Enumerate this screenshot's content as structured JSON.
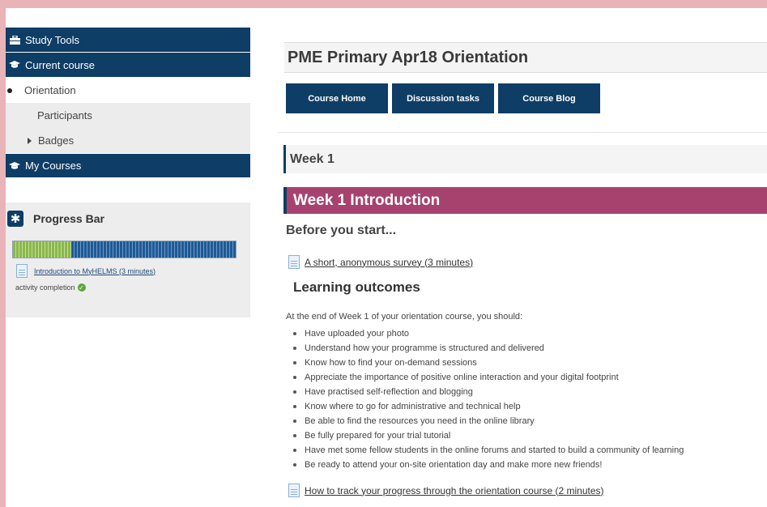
{
  "sidebar": {
    "study_tools": "Study Tools",
    "current_course": "Current course",
    "orientation": "Orientation",
    "participants": "Participants",
    "badges": "Badges",
    "my_courses": "My Courses"
  },
  "progress": {
    "title": "Progress Bar",
    "completed_fraction": 0.26,
    "activity_link": "Introduction to MyHELMS (3 minutes)",
    "status": "activity completion"
  },
  "course": {
    "title": "PME Primary Apr18 Orientation",
    "buttons": [
      "Course Home",
      "Discussion tasks",
      "Course Blog"
    ]
  },
  "week": {
    "label": "Week 1",
    "intro_title": "Week 1 Introduction",
    "before_heading": "Before you start...",
    "survey_link": "A short, anonymous survey (3 minutes)",
    "outcomes_heading": "Learning outcomes",
    "outcomes_intro": "At the end of Week 1 of your orientation course, you should:",
    "outcomes": [
      "Have uploaded your photo",
      "Understand how your programme is structured and delivered",
      "Know how to find your on-demand sessions",
      "Appreciate the importance of positive online interaction and your digital footprint",
      "Have practised self-reflection and blogging",
      "Know where to go for administrative and technical help",
      "Be able to find the resources you need in the online library",
      "Be fully prepared for your trial tutorial",
      "Have met some fellow students in the online forums and started to build a community of learning",
      "Be ready to attend your on-site orientation day and make more new friends!"
    ],
    "progress_link": "How to track your progress through the orientation course (2 minutes)"
  }
}
